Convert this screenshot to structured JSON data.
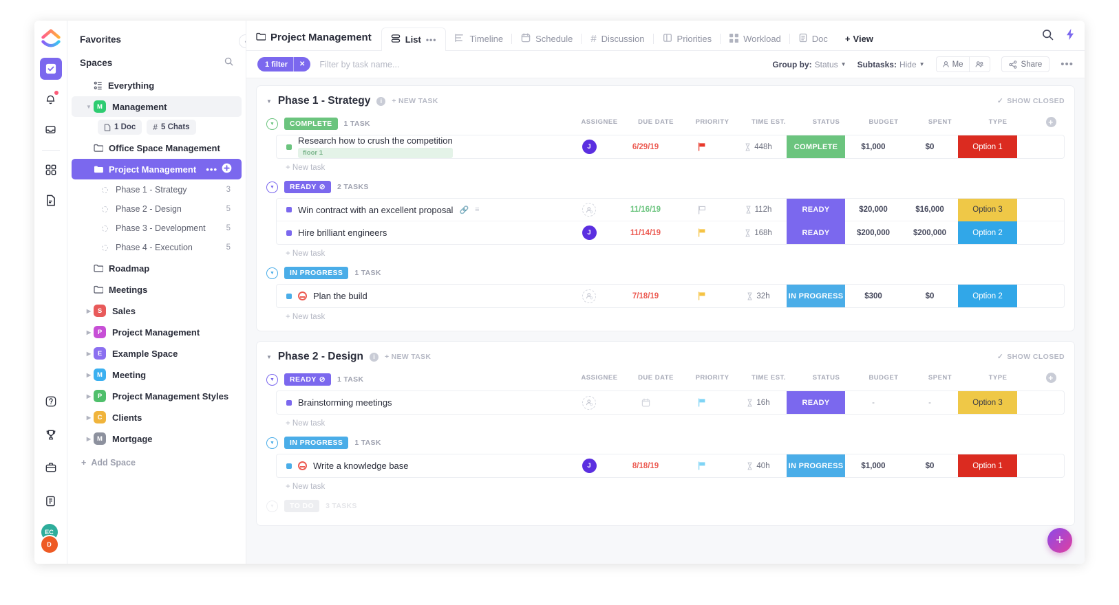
{
  "rail": {
    "logo": "clickup-logo",
    "items": [
      {
        "name": "tasks-icon",
        "active": true
      },
      {
        "name": "notifications-icon",
        "active": false,
        "badge": true
      },
      {
        "name": "inbox-icon",
        "active": false
      },
      {
        "name": "dashboard-icon",
        "active": false
      },
      {
        "name": "docs-icon",
        "active": false
      }
    ],
    "bottom_items": [
      {
        "name": "help-icon"
      },
      {
        "name": "trophy-icon"
      },
      {
        "name": "briefcase-icon"
      },
      {
        "name": "clipboard-icon"
      }
    ],
    "avatars": [
      {
        "initials": "EC",
        "color": "#2ead9b"
      },
      {
        "initials": "D",
        "color": "#ee5a24"
      }
    ]
  },
  "sidebar": {
    "favorites_label": "Favorites",
    "spaces_label": "Spaces",
    "everything_label": "Everything",
    "management": {
      "label": "Management",
      "badge": "M",
      "badge_color": "#2ecc71",
      "chips": [
        {
          "label": "1 Doc",
          "icon": "doc-icon"
        },
        {
          "label": "5 Chats",
          "icon": "hash-icon"
        }
      ],
      "folders": [
        {
          "label": "Office Space Management",
          "selected": false
        },
        {
          "label": "Project Management",
          "selected": true
        }
      ],
      "lists": [
        {
          "label": "Phase 1 - Strategy",
          "count": "3"
        },
        {
          "label": "Phase 2 - Design",
          "count": "5"
        },
        {
          "label": "Phase 3 - Development",
          "count": "5"
        },
        {
          "label": "Phase 4 - Execution",
          "count": "5"
        }
      ],
      "extra_folders": [
        {
          "label": "Roadmap"
        },
        {
          "label": "Meetings"
        }
      ]
    },
    "spaces": [
      {
        "label": "Sales",
        "badge": "S",
        "color": "#e85a5a"
      },
      {
        "label": "Project Management",
        "badge": "P",
        "color": "#c74fd6"
      },
      {
        "label": "Example Space",
        "badge": "E",
        "color": "#8b6ff0"
      },
      {
        "label": "Meeting",
        "badge": "M",
        "color": "#3bb0f0"
      },
      {
        "label": "Project Management Styles",
        "badge": "P",
        "color": "#4fbf6b"
      },
      {
        "label": "Clients",
        "badge": "C",
        "color": "#f0b43c"
      },
      {
        "label": "Mortgage",
        "badge": "M",
        "color": "#8d919e"
      }
    ],
    "add_space_label": "Add Space"
  },
  "topbar": {
    "breadcrumb": "Project Management",
    "tabs": [
      {
        "label": "List",
        "icon": "list-icon",
        "active": true,
        "has_dots": true
      },
      {
        "label": "Timeline",
        "icon": "timeline-icon",
        "active": false
      },
      {
        "label": "Schedule",
        "icon": "calendar-icon",
        "active": false
      },
      {
        "label": "Discussion",
        "icon": "hash-icon",
        "active": false
      },
      {
        "label": "Priorities",
        "icon": "priorities-icon",
        "active": false
      },
      {
        "label": "Workload",
        "icon": "workload-icon",
        "active": false
      },
      {
        "label": "Doc",
        "icon": "doc-icon",
        "active": false
      }
    ],
    "add_view_label": "View",
    "right_icons": [
      "search-icon",
      "lightning-icon"
    ]
  },
  "filterbar": {
    "filter_pill": "1 filter",
    "filter_placeholder": "Filter by task name...",
    "group_by_label": "Group by:",
    "group_by_value": "Status",
    "subtasks_label": "Subtasks:",
    "subtasks_value": "Hide",
    "me_label": "Me",
    "share_label": "Share"
  },
  "columns": [
    "ASSIGNEE",
    "DUE DATE",
    "PRIORITY",
    "TIME EST.",
    "STATUS",
    "BUDGET",
    "SPENT",
    "TYPE"
  ],
  "labels": {
    "new_task_link": "+ NEW TASK",
    "show_closed": "SHOW CLOSED",
    "new_task_row": "+ New task"
  },
  "status_colors": {
    "COMPLETE": "#6bc47e",
    "READY": "#7b68ee",
    "IN PROGRESS": "#4aade8",
    "TO DO": "#c2c5cf"
  },
  "type_colors": {
    "Option 1": {
      "bg": "#db2b20",
      "fg": "#ffffff"
    },
    "Option 2": {
      "bg": "#31a7e8",
      "fg": "#ffffff"
    },
    "Option 3": {
      "bg": "#efc847",
      "fg": "#3c3d47"
    }
  },
  "phases": [
    {
      "title": "Phase 1 - Strategy",
      "groups": [
        {
          "status": "COMPLETE",
          "count_label": "1 TASK",
          "show_columns": true,
          "tasks": [
            {
              "name": "Research how to crush the competition",
              "sub_tag": "floor 1",
              "dot_color": "#6bc47e",
              "assignee": "J",
              "assignee_type": "avatar",
              "due": "6/29/19",
              "due_style": "red",
              "priority_color": "#e8392b",
              "time": "448h",
              "status": "COMPLETE",
              "budget": "$1,000",
              "spent": "$0",
              "type": "Option 1",
              "blocked": false
            }
          ]
        },
        {
          "status": "READY",
          "count_label": "2 TASKS",
          "show_columns": false,
          "tasks": [
            {
              "name": "Win contract with an excellent proposal",
              "dot_color": "#7b68ee",
              "assignee": "",
              "assignee_type": "empty",
              "due": "11/16/19",
              "due_style": "green",
              "priority_color": "#c5c8d2",
              "time": "112h",
              "status": "READY",
              "budget": "$20,000",
              "spent": "$16,000",
              "type": "Option 3",
              "blocked": false,
              "has_attachment": true
            },
            {
              "name": "Hire brilliant engineers",
              "dot_color": "#7b68ee",
              "assignee": "J",
              "assignee_type": "avatar",
              "due": "11/14/19",
              "due_style": "red",
              "priority_color": "#f5c344",
              "time": "168h",
              "status": "READY",
              "budget": "$200,000",
              "spent": "$200,000",
              "type": "Option 2",
              "blocked": false
            }
          ]
        },
        {
          "status": "IN PROGRESS",
          "count_label": "1 TASK",
          "show_columns": false,
          "tasks": [
            {
              "name": "Plan the build",
              "dot_color": "#4aade8",
              "assignee": "",
              "assignee_type": "empty",
              "due": "7/18/19",
              "due_style": "red",
              "priority_color": "#f5c344",
              "time": "32h",
              "status": "IN PROGRESS",
              "budget": "$300",
              "spent": "$0",
              "type": "Option 2",
              "blocked": true
            }
          ]
        }
      ]
    },
    {
      "title": "Phase 2 - Design",
      "groups": [
        {
          "status": "READY",
          "count_label": "1 TASK",
          "show_columns": true,
          "tasks": [
            {
              "name": "Brainstorming meetings",
              "dot_color": "#7b68ee",
              "assignee": "",
              "assignee_type": "empty",
              "due": "",
              "due_style": "empty",
              "priority_color": "#7fd4f5",
              "time": "16h",
              "status": "READY",
              "budget": "-",
              "spent": "-",
              "type": "Option 3",
              "blocked": false
            }
          ]
        },
        {
          "status": "IN PROGRESS",
          "count_label": "1 TASK",
          "show_columns": false,
          "tasks": [
            {
              "name": "Write a knowledge base",
              "dot_color": "#4aade8",
              "assignee": "J",
              "assignee_type": "avatar",
              "due": "8/18/19",
              "due_style": "red",
              "priority_color": "#7fd4f5",
              "time": "40h",
              "status": "IN PROGRESS",
              "budget": "$1,000",
              "spent": "$0",
              "type": "Option 1",
              "blocked": true
            }
          ]
        },
        {
          "status": "TO DO",
          "count_label": "3 TASKS",
          "show_columns": false,
          "partial": true,
          "tasks": []
        }
      ]
    }
  ]
}
